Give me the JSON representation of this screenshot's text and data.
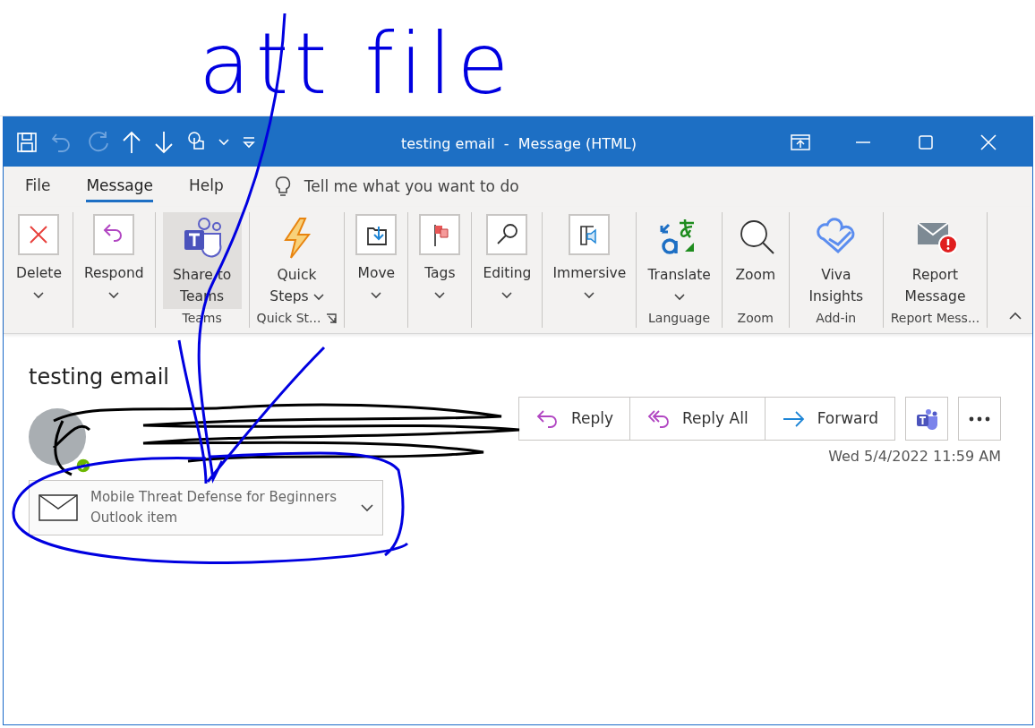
{
  "annotation": {
    "label": "att file"
  },
  "window": {
    "title": "testing email  -  Message (HTML)"
  },
  "menu_tabs": [
    {
      "label": "File",
      "selected": false
    },
    {
      "label": "Message",
      "selected": true
    },
    {
      "label": "Help",
      "selected": false
    }
  ],
  "tell_me": {
    "placeholder": "Tell me what you want to do"
  },
  "ribbon_groups": [
    {
      "buttons": [
        {
          "kind": "delete",
          "label": "Delete",
          "dropdown": true,
          "highlighted": false
        }
      ]
    },
    {
      "buttons": [
        {
          "kind": "respond",
          "label": "Respond",
          "dropdown": true,
          "highlighted": false
        }
      ]
    },
    {
      "label": "Teams",
      "buttons": [
        {
          "kind": "teams",
          "label": "Share to Teams",
          "dropdown": false,
          "highlighted": true
        }
      ]
    },
    {
      "label": "Quick St...",
      "launcher": true,
      "buttons": [
        {
          "kind": "quick-steps",
          "label": "Quick Steps",
          "dropdown": true,
          "highlighted": false
        }
      ]
    },
    {
      "buttons": [
        {
          "kind": "move",
          "label": "Move",
          "dropdown": true,
          "highlighted": false
        }
      ]
    },
    {
      "buttons": [
        {
          "kind": "tags",
          "label": "Tags",
          "dropdown": true,
          "highlighted": false
        }
      ]
    },
    {
      "buttons": [
        {
          "kind": "editing",
          "label": "Editing",
          "dropdown": true,
          "highlighted": false
        }
      ]
    },
    {
      "buttons": [
        {
          "kind": "immersive",
          "label": "Immersive",
          "dropdown": true,
          "highlighted": false
        }
      ]
    },
    {
      "label": "Language",
      "buttons": [
        {
          "kind": "translate",
          "label": "Translate",
          "dropdown": true,
          "highlighted": false
        }
      ]
    },
    {
      "label": "Zoom",
      "buttons": [
        {
          "kind": "zoom",
          "label": "Zoom",
          "dropdown": false,
          "highlighted": false
        }
      ]
    },
    {
      "label": "Add-in",
      "buttons": [
        {
          "kind": "viva",
          "label": "Viva Insights",
          "dropdown": false,
          "highlighted": false
        }
      ]
    },
    {
      "label": "Report Mess...",
      "buttons": [
        {
          "kind": "report",
          "label": "Report Message",
          "dropdown": false,
          "highlighted": false
        }
      ]
    }
  ],
  "message": {
    "subject": "testing email",
    "actions": [
      {
        "kind": "reply",
        "label": "Reply"
      },
      {
        "kind": "reply-all",
        "label": "Reply All"
      },
      {
        "kind": "forward",
        "label": "Forward"
      }
    ],
    "date": "Wed 5/4/2022 11:59 AM",
    "attachment": {
      "name": "Mobile Threat Defense for Beginners",
      "type": "Outlook item"
    }
  }
}
